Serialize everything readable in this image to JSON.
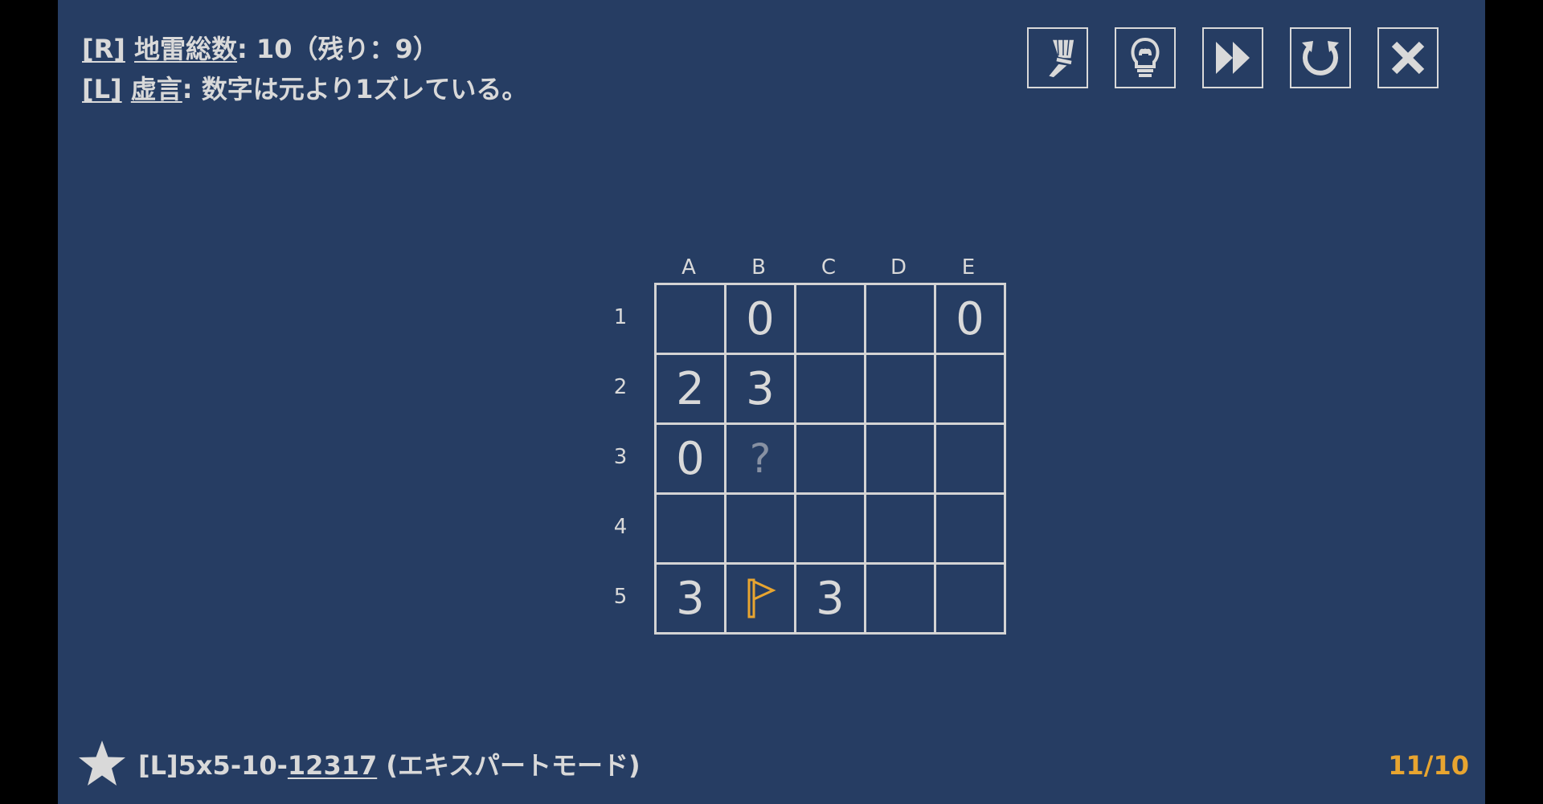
{
  "rules": {
    "line1_tag": "[R]",
    "line1_term": "地雷総数",
    "line1_text": ": 10（残り：9）",
    "line2_tag": "[L]",
    "line2_term": "虚言",
    "line2_text": ": 数字は元より1ズレている。"
  },
  "toolbar": {
    "buttons": [
      {
        "name": "brush-icon",
        "label": "clear"
      },
      {
        "name": "lightbulb-icon",
        "label": "hint"
      },
      {
        "name": "fast-forward-icon",
        "label": "skip"
      },
      {
        "name": "restart-icon",
        "label": "restart"
      },
      {
        "name": "close-icon",
        "label": "close"
      }
    ]
  },
  "board": {
    "columns": [
      "A",
      "B",
      "C",
      "D",
      "E"
    ],
    "rows": [
      "1",
      "2",
      "3",
      "4",
      "5"
    ],
    "cells": [
      [
        "",
        "0",
        "",
        "",
        "0"
      ],
      [
        "2",
        "3",
        "",
        "",
        ""
      ],
      [
        "0",
        "?",
        "",
        "",
        ""
      ],
      [
        "",
        "",
        "",
        "",
        ""
      ],
      [
        "3",
        "flag",
        "3",
        "",
        ""
      ]
    ]
  },
  "footer": {
    "puzzle_prefix": "[L]5x5-10-",
    "puzzle_number": "12317",
    "puzzle_mode": " (エキスパートモード)",
    "progress": "11/10"
  },
  "colors": {
    "background": "#263d63",
    "text": "#d9d9d9",
    "accent": "#e8a530",
    "unknown": "#8791a3"
  }
}
